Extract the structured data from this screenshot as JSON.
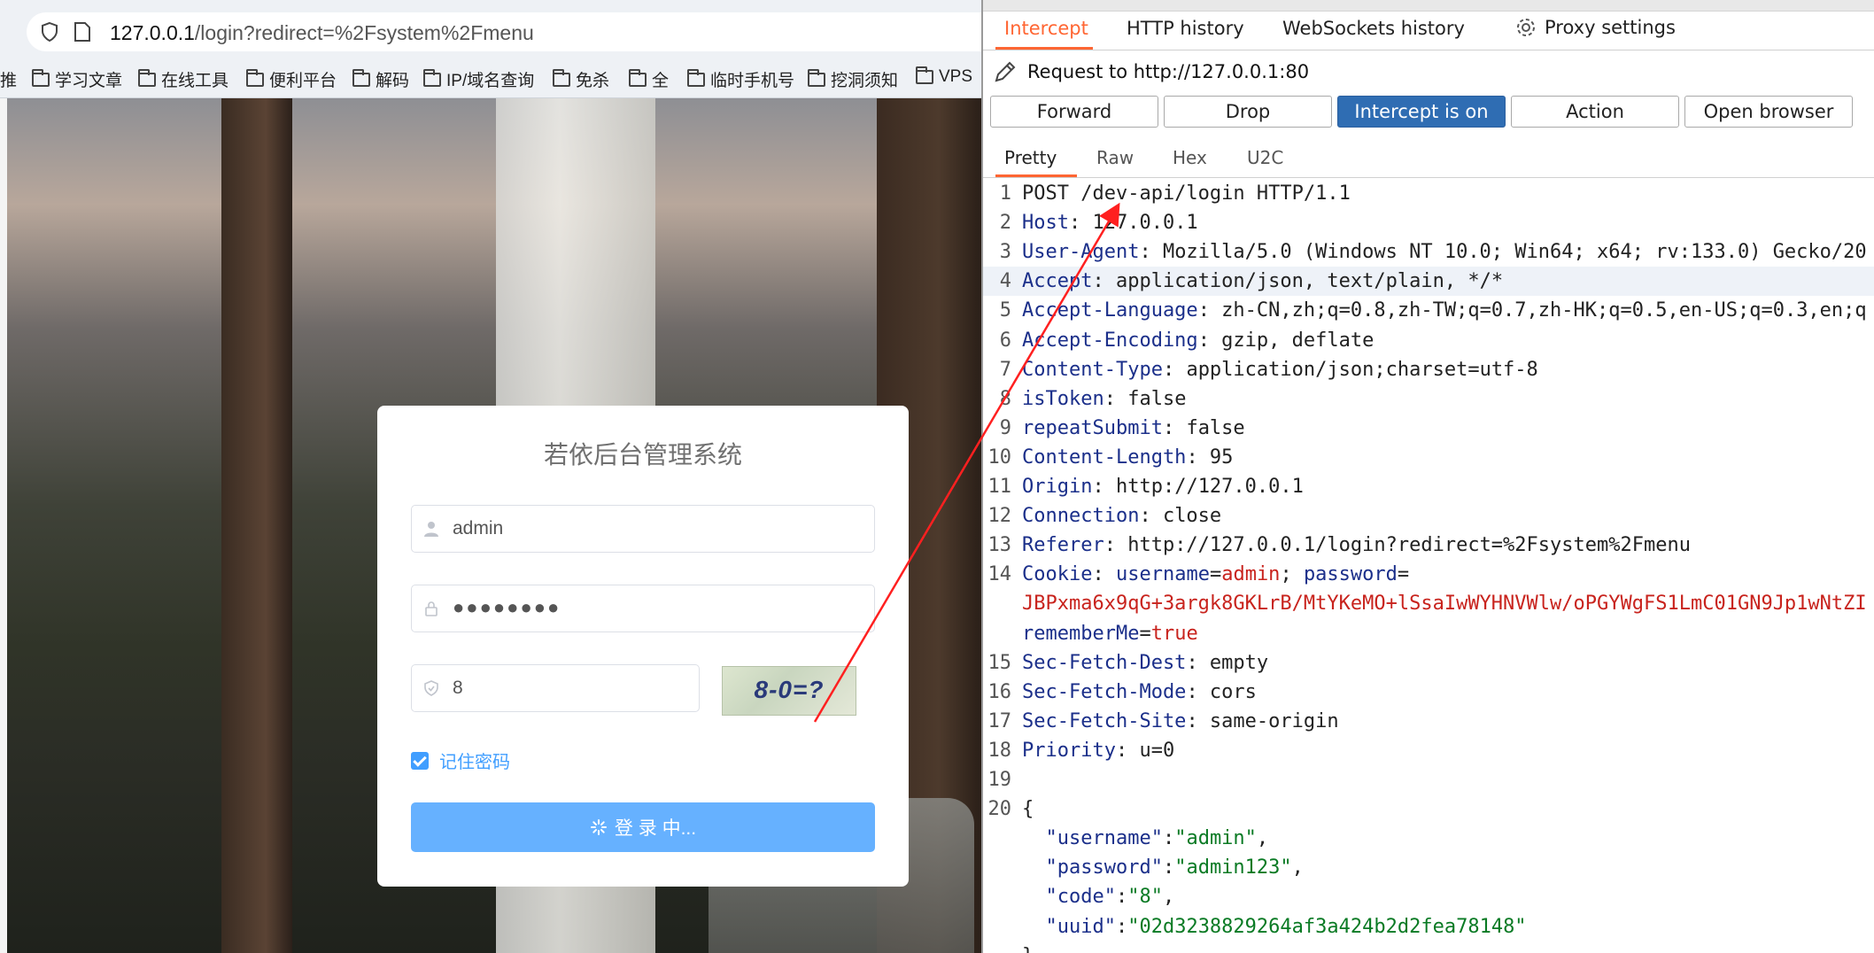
{
  "browser": {
    "url_host": "127.0.0.1",
    "url_path": "/login?redirect=%2Fsystem%2Fmenu",
    "bookmarks": [
      "学习文章",
      "在线工具",
      "便利平台",
      "解码",
      "IP/域名查询",
      "免杀",
      "全",
      "临时手机号",
      "挖洞须知",
      "VPS"
    ],
    "bookmark_prefix": "推"
  },
  "login": {
    "title": "若依后台管理系统",
    "username": "admin",
    "password_mask": "●●●●●●●●",
    "code": "8",
    "captcha": "8-0=?",
    "remember_label": "记住密码",
    "button_label": "登 录 中..."
  },
  "burp": {
    "tabs": [
      "Intercept",
      "HTTP history",
      "WebSockets history",
      "Proxy settings"
    ],
    "request_to": "Request to http://127.0.0.1:80",
    "buttons": [
      "Forward",
      "Drop",
      "Intercept is on",
      "Action",
      "Open browser"
    ],
    "view_tabs": [
      "Pretty",
      "Raw",
      "Hex",
      "U2C"
    ],
    "lines": [
      {
        "n": "1",
        "parts": [
          {
            "t": "POST /dev-api/login HTTP/1.1",
            "c": ""
          }
        ]
      },
      {
        "n": "2",
        "parts": [
          {
            "t": "Host",
            "c": "hk"
          },
          {
            "t": ": 127.0.0.1",
            "c": ""
          }
        ]
      },
      {
        "n": "3",
        "parts": [
          {
            "t": "User-Agent",
            "c": "hk"
          },
          {
            "t": ": Mozilla/5.0 (Windows NT 10.0; Win64; x64; rv:133.0) Gecko/20",
            "c": ""
          }
        ]
      },
      {
        "n": "4",
        "parts": [
          {
            "t": "Accept",
            "c": "hk"
          },
          {
            "t": ": application/json, text/plain, */*",
            "c": ""
          }
        ],
        "hl": true
      },
      {
        "n": "5",
        "parts": [
          {
            "t": "Accept-Language",
            "c": "hk"
          },
          {
            "t": ": zh-CN,zh;q=0.8,zh-TW;q=0.7,zh-HK;q=0.5,en-US;q=0.3,en;q",
            "c": ""
          }
        ]
      },
      {
        "n": "6",
        "parts": [
          {
            "t": "Accept-Encoding",
            "c": "hk"
          },
          {
            "t": ": gzip, deflate",
            "c": ""
          }
        ]
      },
      {
        "n": "7",
        "parts": [
          {
            "t": "Content-Type",
            "c": "hk"
          },
          {
            "t": ": application/json;charset=utf-8",
            "c": ""
          }
        ]
      },
      {
        "n": "8",
        "parts": [
          {
            "t": "isToken",
            "c": "hk"
          },
          {
            "t": ": false",
            "c": ""
          }
        ]
      },
      {
        "n": "9",
        "parts": [
          {
            "t": "repeatSubmit",
            "c": "hk"
          },
          {
            "t": ": false",
            "c": ""
          }
        ]
      },
      {
        "n": "10",
        "parts": [
          {
            "t": "Content-Length",
            "c": "hk"
          },
          {
            "t": ": 95",
            "c": ""
          }
        ]
      },
      {
        "n": "11",
        "parts": [
          {
            "t": "Origin",
            "c": "hk"
          },
          {
            "t": ": http://127.0.0.1",
            "c": ""
          }
        ]
      },
      {
        "n": "12",
        "parts": [
          {
            "t": "Connection",
            "c": "hk"
          },
          {
            "t": ": close",
            "c": ""
          }
        ]
      },
      {
        "n": "13",
        "parts": [
          {
            "t": "Referer",
            "c": "hk"
          },
          {
            "t": ": http://127.0.0.1/login?redirect=%2Fsystem%2Fmenu",
            "c": ""
          }
        ]
      },
      {
        "n": "14",
        "parts": [
          {
            "t": "Cookie",
            "c": "hk"
          },
          {
            "t": ": ",
            "c": ""
          },
          {
            "t": "username",
            "c": "hk"
          },
          {
            "t": "=",
            "c": ""
          },
          {
            "t": "admin",
            "c": "cv"
          },
          {
            "t": "; ",
            "c": ""
          },
          {
            "t": "password",
            "c": "hk"
          },
          {
            "t": "=",
            "c": ""
          }
        ]
      },
      {
        "n": "",
        "parts": [
          {
            "t": "JBPxma6x9qG+3argk8GKLrB/MtYKeMO+lSsaIwWYHNVWlw/oPGYWgFS1LmC01GN9Jp1wNtZI",
            "c": "cv"
          }
        ]
      },
      {
        "n": "",
        "parts": [
          {
            "t": "rememberMe",
            "c": "hk"
          },
          {
            "t": "=",
            "c": ""
          },
          {
            "t": "true",
            "c": "cv"
          }
        ]
      },
      {
        "n": "15",
        "parts": [
          {
            "t": "Sec-Fetch-Dest",
            "c": "hk"
          },
          {
            "t": ": empty",
            "c": ""
          }
        ]
      },
      {
        "n": "16",
        "parts": [
          {
            "t": "Sec-Fetch-Mode",
            "c": "hk"
          },
          {
            "t": ": cors",
            "c": ""
          }
        ]
      },
      {
        "n": "17",
        "parts": [
          {
            "t": "Sec-Fetch-Site",
            "c": "hk"
          },
          {
            "t": ": same-origin",
            "c": ""
          }
        ]
      },
      {
        "n": "18",
        "parts": [
          {
            "t": "Priority",
            "c": "hk"
          },
          {
            "t": ": u=0",
            "c": ""
          }
        ]
      },
      {
        "n": "19",
        "parts": []
      },
      {
        "n": "20",
        "parts": [
          {
            "t": "{",
            "c": ""
          }
        ]
      },
      {
        "n": "",
        "parts": [
          {
            "t": "  \"username\"",
            "c": "jk"
          },
          {
            "t": ":",
            "c": ""
          },
          {
            "t": "\"admin\"",
            "c": "jv"
          },
          {
            "t": ",",
            "c": ""
          }
        ]
      },
      {
        "n": "",
        "parts": [
          {
            "t": "  \"password\"",
            "c": "jk"
          },
          {
            "t": ":",
            "c": ""
          },
          {
            "t": "\"admin123\"",
            "c": "jv"
          },
          {
            "t": ",",
            "c": ""
          }
        ]
      },
      {
        "n": "",
        "parts": [
          {
            "t": "  \"code\"",
            "c": "jk"
          },
          {
            "t": ":",
            "c": ""
          },
          {
            "t": "\"8\"",
            "c": "jv"
          },
          {
            "t": ",",
            "c": ""
          }
        ]
      },
      {
        "n": "",
        "parts": [
          {
            "t": "  \"uuid\"",
            "c": "jk"
          },
          {
            "t": ":",
            "c": ""
          },
          {
            "t": "\"02d3238829264af3a424b2d2fea78148\"",
            "c": "jv"
          }
        ]
      },
      {
        "n": "",
        "parts": [
          {
            "t": "}",
            "c": ""
          }
        ]
      }
    ]
  },
  "annotation": {
    "arrow_color": "#ff2020"
  }
}
